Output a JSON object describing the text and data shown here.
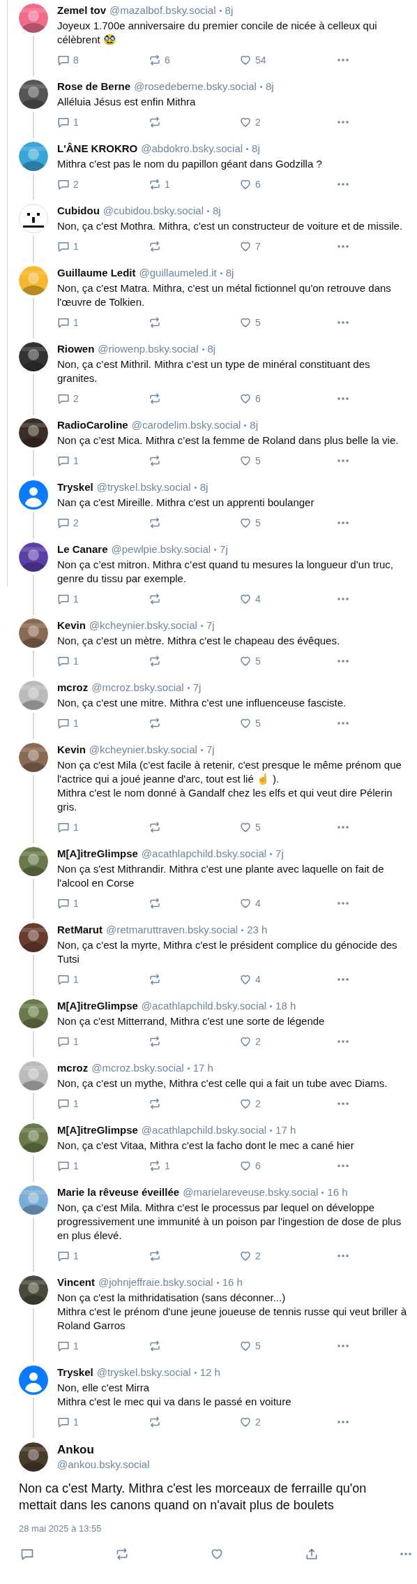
{
  "replies": [
    {
      "name": "Zemel tov",
      "handle": "@mazalbof.bsky.social",
      "time": "8j",
      "text": "Joyeux 1.700e anniversaire du premier concile de nicée à celleux qui célèbrent 🥸",
      "replies": "8",
      "reposts": "6",
      "likes": "54"
    },
    {
      "name": "Rose de Berne",
      "handle": "@rosedeberne.bsky.social",
      "time": "8j",
      "text": "Alléluia Jésus est enfin Mithra",
      "replies": "1",
      "likes": "2"
    },
    {
      "name": "L'ÂNE KROKRO",
      "handle": "@abdokro.bsky.social",
      "time": "8j",
      "text": "Mithra c'est pas le nom du papillon géant dans Godzilla ?",
      "replies": "2",
      "reposts": "1",
      "likes": "6"
    },
    {
      "name": "Cubidou",
      "handle": "@cubidou.bsky.social",
      "time": "8j",
      "text": "Non, ça c'est Mothra. Mithra, c'est un constructeur de voiture et de missile.",
      "avatar": {
        "kind": "face-mark"
      },
      "replies": "1",
      "likes": "7"
    },
    {
      "name": "Guillaume Ledit",
      "handle": "@guillaumeled.it",
      "time": "8j",
      "text": "Non, ça c'est Matra. Mithra, c'est un métal fictionnel qu'on retrouve dans l'œuvre de Tolkien.",
      "replies": "1",
      "likes": "5"
    },
    {
      "name": "Riowen",
      "handle": "@riowenp.bsky.social",
      "time": "8j",
      "text": "Non, ça c’est Mithril. Mithra c’est un type de minéral constituant des granites.",
      "replies": "2",
      "likes": "6"
    },
    {
      "name": "RadioCaroline",
      "handle": "@carodelim.bsky.social",
      "time": "8j",
      "text": "Non ça c’est Mica. Mithra c’est la femme de Roland dans plus belle la vie.",
      "replies": "1",
      "likes": "5"
    },
    {
      "name": "Tryskel",
      "handle": "@tryskel.bsky.social",
      "time": "8j",
      "text": "Nan ça c'est Mireille. Mithra c'est un apprenti boulanger",
      "avatar": {
        "kind": "default"
      },
      "replies": "2",
      "likes": "5"
    },
    {
      "name": "Le Canare",
      "handle": "@pewlpie.bsky.social",
      "time": "7j",
      "text": "Non ça c’est mitron. Mithra c’est quand tu mesures la longueur d’un truc, genre du tissu par exemple.",
      "replies": "1",
      "likes": "4"
    },
    {
      "name": "Kevin",
      "handle": "@kcheynier.bsky.social",
      "time": "7j",
      "text": "Non, ça c'est un mètre. Mithra c'est le chapeau des évêques.",
      "replies": "1",
      "likes": "5"
    },
    {
      "name": "mcroz",
      "handle": "@mcroz.bsky.social",
      "time": "7j",
      "text": "Non, ça c'est une mitre. Mithra c'est une influenceuse fasciste.",
      "replies": "1",
      "likes": "5"
    },
    {
      "name": "Kevin",
      "handle": "@kcheynier.bsky.social",
      "time": "7j",
      "text": "Non ça c'est Mila (c'est facile à retenir, c'est presque le même prénom que l'actrice qui a joué jeanne d'arc, tout est lié ☝ ).\nMithra c'est le nom donné à Gandalf chez les elfs et qui veut dire Pélerin gris.",
      "replies": "1",
      "likes": "5"
    },
    {
      "name": "M[A]itreGlimpse",
      "handle": "@acathlapchild.bsky.social",
      "time": "7j",
      "text": "Non ça s'est Mithrandir. Mithra c'est une plante avec laquelle on fait de l'alcool en Corse",
      "replies": "1",
      "likes": "4"
    },
    {
      "name": "RetMarut",
      "handle": "@retmaruttraven.bsky.social",
      "time": "23 h",
      "text": "Non, ça c'est la myrte, Mithra c'est le président complice du génocide des Tutsi",
      "replies": "1",
      "likes": "4"
    },
    {
      "name": "M[A]itreGlimpse",
      "handle": "@acathlapchild.bsky.social",
      "time": "18 h",
      "text": "Non ça c'est Mitterrand, Mithra c'est une sorte de légende",
      "replies": "1",
      "likes": "2"
    },
    {
      "name": "mcroz",
      "handle": "@mcroz.bsky.social",
      "time": "17 h",
      "text": "Non, ça c'est un mythe, Mithra c'est celle qui a fait un tube avec Diams.",
      "replies": "1",
      "likes": "2"
    },
    {
      "name": "M[A]itreGlimpse",
      "handle": "@acathlapchild.bsky.social",
      "time": "17 h",
      "text": "Non, ça c'est Vitaa, Mithra c'est la facho dont le mec a cané hier",
      "replies": "1",
      "reposts": "1",
      "likes": "6"
    },
    {
      "name": "Marie la rêveuse éveillée",
      "handle": "@marielareveuse.bsky.social",
      "time": "16 h",
      "text": "Non, ça c'est Mila. Mithra c'est le processus par lequel on développe progressivement une immunité à un poison par l'ingestion de dose de plus en plus élevé.",
      "replies": "1",
      "likes": "2"
    },
    {
      "name": "Vincent",
      "handle": "@johnjeffraie.bsky.social",
      "time": "16 h",
      "text": "Non ça c'est la mithridatisation (sans déconner...)\nMithra c'est le prénom d'une jeune joueuse de tennis russe qui veut briller à Roland Garros",
      "replies": "1",
      "likes": "5"
    },
    {
      "name": "Tryskel",
      "handle": "@tryskel.bsky.social",
      "time": "12 h",
      "text": "Non, elle c'est Mirra\nMithra c'est le mec qui va dans le passé en voiture",
      "avatar": {
        "kind": "default"
      },
      "replies": "1",
      "likes": "2"
    }
  ],
  "main_post": {
    "name": "Ankou",
    "handle": "@ankou.bsky.social",
    "text": "Non ca c'est Marty. Mithra c'est les morceaux de ferraille qu'on mettait dans les canons quand on n'avait plus de boulets",
    "date": "28 mai 2025 à 13:55"
  }
}
